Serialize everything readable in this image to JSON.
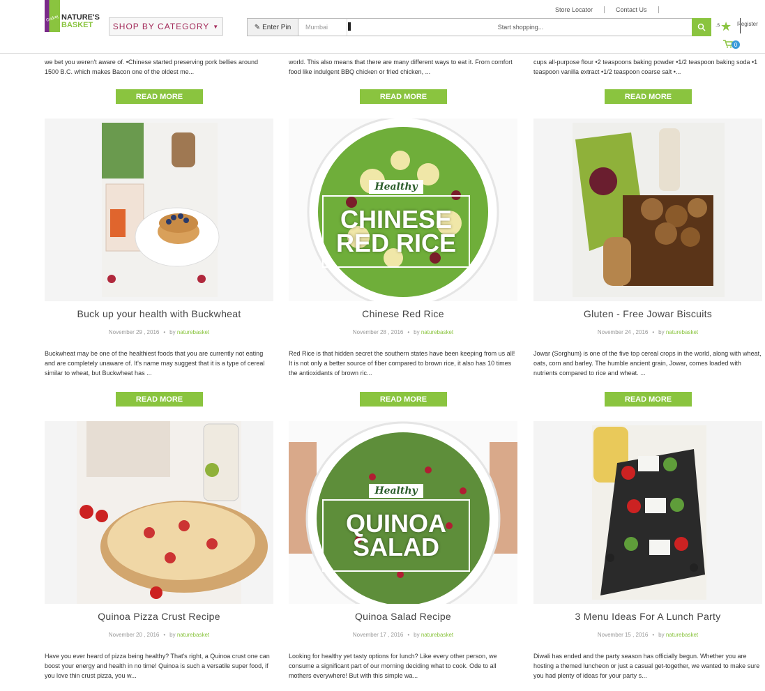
{
  "header": {
    "logo": {
      "line1": "NATURE'S",
      "line2": "BASKET",
      "tag": "Godrej"
    },
    "shop_by_category": "SHOP BY CATEGORY",
    "enter_pin": "Enter Pin",
    "city": "Mumbai",
    "search_placeholder": "Start shopping...",
    "links": [
      "Store Locator",
      "Contact Us"
    ],
    "register": "Register",
    "cart_count": "0",
    "dot_text": ".s"
  },
  "colors": {
    "accent": "#8ac43f",
    "brand": "#a32b5a"
  },
  "top_excerpts": [
    "we bet you weren't aware of. •Chinese started preserving pork bellies around 1500 B.C. which makes Bacon one of the oldest me...",
    "world. This also means that there are many different ways to eat it. From comfort food like indulgent BBQ chicken or fried chicken, ...",
    "cups all-purpose flour •2 teaspoons baking powder •1/2 teaspoon baking soda •1 teaspoon vanilla extract •1/2 teaspoon coarse salt •..."
  ],
  "read_more": "READ MORE",
  "by": "by",
  "posts": [
    {
      "title": "Buck up your health with Buckwheat",
      "date": "November 29 , 2016",
      "author": "naturebasket",
      "excerpt": "Buckwheat may be one of the healthiest foods that you are currently not eating and are completely unaware of. It's name may suggest that it is a type of cereal similar to wheat, but Buckwheat has ..."
    },
    {
      "title": "Chinese Red Rice",
      "date": "November 28 , 2016",
      "author": "naturebasket",
      "excerpt": "Red Rice is that hidden secret the southern states have been keeping from us all! It is not only a better source of fiber compared to brown rice, it also has 10 times the antioxidants of brown ric...",
      "overlay": {
        "badge": "Healthy",
        "big1": "CHINESE",
        "big2": "RED RICE"
      }
    },
    {
      "title": "Gluten - Free Jowar Biscuits",
      "date": "November 24 , 2016",
      "author": "naturebasket",
      "excerpt": "Jowar (Sorghum) is one of the five top cereal crops in the world, along with wheat, oats, corn and barley. The humble ancient grain, Jowar, comes loaded with nutrients compared to rice and wheat. ..."
    },
    {
      "title": "Quinoa Pizza Crust Recipe",
      "date": "November 20 , 2016",
      "author": "naturebasket",
      "excerpt": "Have you ever heard of pizza being healthy? That's right, a Quinoa crust one can boost your energy and health in no time! Quinoa is such a versatile super food, if you love thin crust pizza, you w..."
    },
    {
      "title": "Quinoa Salad Recipe",
      "date": "November 17 , 2016",
      "author": "naturebasket",
      "excerpt": "Looking for healthy yet tasty options for lunch? Like every other person, we consume a significant part of our morning deciding what to cook. Ode to all mothers everywhere! But with this simple wa...",
      "overlay": {
        "badge": "Healthy",
        "big1": "QUINOA",
        "big2": "SALAD"
      }
    },
    {
      "title": "3 Menu Ideas For A Lunch Party",
      "date": "November 15 , 2016",
      "author": "naturebasket",
      "excerpt": "Diwali has ended and the party season has officially begun. Whether you are hosting a themed luncheon or just a casual get-together, we wanted to make sure you had plenty of ideas for your party s..."
    }
  ]
}
